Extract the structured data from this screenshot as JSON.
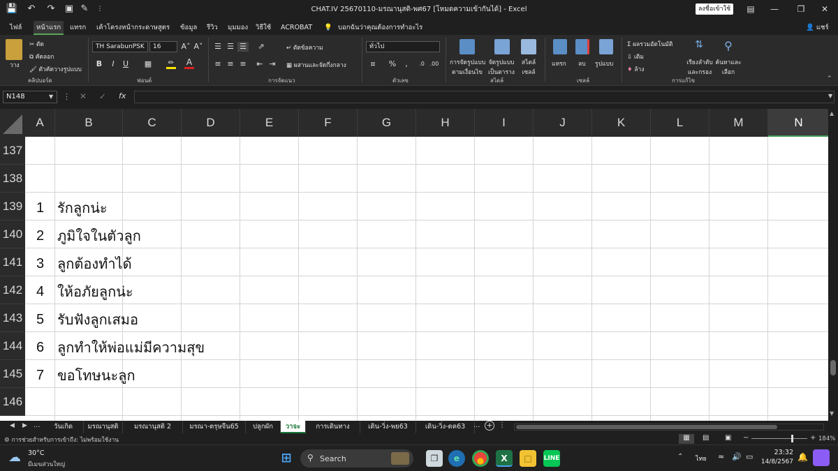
{
  "window": {
    "title": "CHAT.IV 25670110-มรณานุสติ-พศ67  [โหมดความเข้ากันได้]  -  Excel",
    "signin_label": "ลงชื่อเข้าใช้"
  },
  "menu": {
    "tabs": [
      "ไฟล์",
      "หน้าแรก",
      "แทรก",
      "เค้าโครงหน้ากระดาษ",
      "สูตร",
      "ข้อมูล",
      "รีวิว",
      "มุมมอง",
      "วิธีใช้",
      "ACROBAT"
    ],
    "tell_me": "บอกฉันว่าคุณต้องการทำอะไร",
    "share": "แชร์"
  },
  "ribbon": {
    "clipboard": {
      "paste": "วาง",
      "cut": "ตัด",
      "copy": "คัดลอก",
      "format_painter": "ตัวคัดวางรูปแบบ",
      "label": "คลิปบอร์ด"
    },
    "font": {
      "name": "TH SarabunPSK",
      "size": "16",
      "label": "ฟอนต์"
    },
    "alignment": {
      "wrap": "ตัดข้อความ",
      "merge": "ผสานและจัดกึ่งกลาง",
      "label": "การจัดแนว"
    },
    "number": {
      "format": "ทั่วไป",
      "label": "ตัวเลข"
    },
    "styles": {
      "conditional": "การจัดรูปแบบ",
      "conditional2": "ตามเงื่อนไข",
      "as_table": "จัดรูปแบบ",
      "as_table2": "เป็นตาราง",
      "cell_styles": "สไตล์",
      "cell_styles2": "เซลล์",
      "label": "สไตล์"
    },
    "cells": {
      "insert": "แทรก",
      "delete": "ลบ",
      "format": "รูปแบบ",
      "label": "เซลล์"
    },
    "editing": {
      "autosum": "ผลรวมอัตโนมัติ",
      "fill": "เติม",
      "clear": "ล้าง",
      "sort": "เรียงลำดับ",
      "sort2": "และกรอง",
      "find": "ค้นหาและ",
      "find2": "เลือก",
      "label": "การแก้ไข"
    }
  },
  "formula_bar": {
    "name_box": "N148",
    "fx": "fx",
    "value": ""
  },
  "columns": [
    "A",
    "B",
    "C",
    "D",
    "E",
    "F",
    "G",
    "H",
    "I",
    "J",
    "K",
    "L",
    "M",
    "N"
  ],
  "selected_column": "N",
  "rows": [
    {
      "num": "137",
      "a": "",
      "b": ""
    },
    {
      "num": "138",
      "a": "",
      "b": ""
    },
    {
      "num": "139",
      "a": "1",
      "b": "รักลูกน่ะ"
    },
    {
      "num": "140",
      "a": "2",
      "b": "ภูมิใจในตัวลูก"
    },
    {
      "num": "141",
      "a": "3",
      "b": "ลูกต้องทำได้"
    },
    {
      "num": "142",
      "a": "4",
      "b": "ให้อภัยลูกน่ะ"
    },
    {
      "num": "143",
      "a": "5",
      "b": "รับฟังลูกเสมอ"
    },
    {
      "num": "144",
      "a": "6",
      "b": "ลูกทำให้พ่อแม่มีความสุข"
    },
    {
      "num": "145",
      "a": "7",
      "b": "ขอโทษนะลูก"
    },
    {
      "num": "146",
      "a": "",
      "b": ""
    }
  ],
  "sheets": {
    "tabs": [
      "วันเกิด",
      "มรณานุสติ",
      "มรณานุสติ 2",
      "มรณา-ตรุษจีน65",
      "ปลูกผัก",
      "วาจะ",
      "การเดินทาง",
      "เดิน-วิ่ง-พย63",
      "เดิน-วิ่ง-ตค63"
    ],
    "active": "วาจะ",
    "more": "..."
  },
  "status": {
    "text": "การช่วยสำหรับการเข้าถึง: ไม่พร้อมใช้งาน",
    "zoom": "184%",
    "zoom_fraction": 0.73
  },
  "taskbar": {
    "weather_temp": "30°C",
    "weather_desc": "มีเมฆส่วนใหญ่",
    "search": "Search",
    "lang": "ไทย",
    "time": "23:32",
    "date": "14/8/2567"
  },
  "colors": {
    "accent": "#1a7a3a",
    "selection": "#3f9a56"
  }
}
